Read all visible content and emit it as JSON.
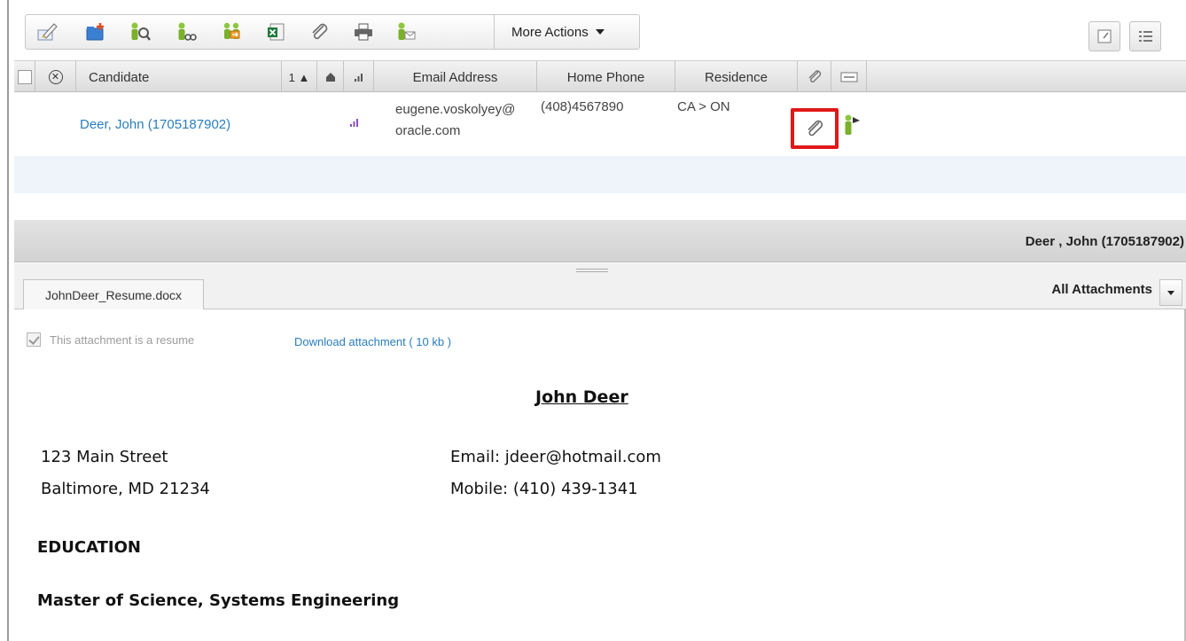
{
  "toolbar": {
    "icons": [
      "edit-icon",
      "add-to-folder-icon",
      "find-candidate-icon",
      "match-candidate-icon",
      "share-candidate-icon",
      "export-excel-icon",
      "attach-icon",
      "print-icon",
      "email-candidate-icon"
    ],
    "more_actions_label": "More Actions",
    "view_buttons": [
      "detail-view-icon",
      "list-view-icon"
    ]
  },
  "grid": {
    "columns": {
      "candidate": "Candidate",
      "sort_indicator": "1 ▲",
      "email": "Email Address",
      "home_phone": "Home Phone",
      "residence": "Residence"
    },
    "rows": [
      {
        "candidate": "Deer, John (1705187902)",
        "email_line1": "eugene.voskolyey@",
        "email_line2": "oracle.com",
        "home_phone": "(408)4567890",
        "residence": "CA > ON"
      }
    ]
  },
  "detail": {
    "title": "Deer , John (1705187902)",
    "tab_label": "JohnDeer_Resume.docx",
    "all_attachments_label": "All Attachments",
    "resume_checkbox_label": "This attachment is a resume",
    "download_label": "Download attachment ( 10 kb )"
  },
  "document": {
    "name": "John Deer",
    "address_line1": "123 Main Street",
    "address_line2": "Baltimore, MD 21234",
    "email": "Email: jdeer@hotmail.com",
    "mobile": "Mobile: (410) 439-1341",
    "section_heading": "EDUCATION",
    "degree": "Master of Science, Systems Engineering"
  },
  "colors": {
    "link": "#2a7dc0",
    "highlight": "#e01818",
    "icon_green": "#7ab02a",
    "rank_purple": "#8a4fc0"
  }
}
